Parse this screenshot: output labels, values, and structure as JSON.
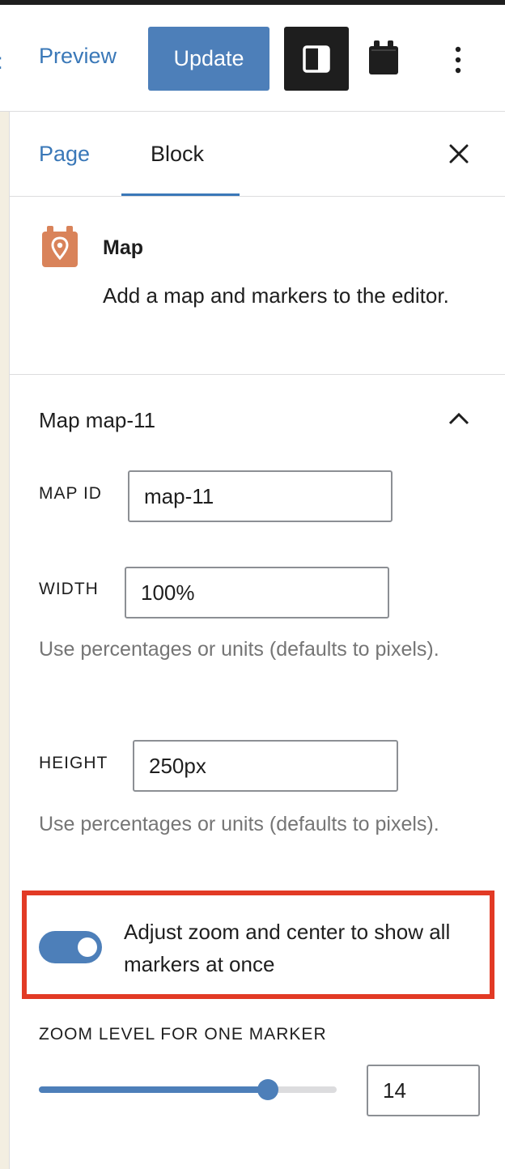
{
  "header": {
    "colon_glyph": ":",
    "preview_label": "Preview",
    "update_label": "Update"
  },
  "tabs": {
    "page_label": "Page",
    "block_label": "Block"
  },
  "block_card": {
    "title": "Map",
    "description": "Add a map and markers to the editor."
  },
  "panel": {
    "title": "Map map-11",
    "map_id": {
      "label": "MAP ID",
      "value": "map-11"
    },
    "width": {
      "label": "WIDTH",
      "value": "100%",
      "help": "Use percentages or units (defaults to pixels)."
    },
    "height": {
      "label": "HEIGHT",
      "value": "250px",
      "help": "Use percentages or units (defaults to pixels)."
    },
    "fit_markers": {
      "label": "Adjust zoom and center to show all markers at once",
      "checked": true
    },
    "zoom": {
      "label": "ZOOM LEVEL FOR ONE MARKER",
      "value": "14",
      "slider_fraction": 0.77
    }
  },
  "colors": {
    "accent": "#3a78b8",
    "button": "#4d7fb9",
    "highlight": "#e23a25",
    "block_icon": "#d9835a"
  },
  "icons": [
    "sidebar-toggle-icon",
    "plugin-calendar-icon",
    "more-vertical-icon",
    "close-icon",
    "map-pin-icon",
    "chevron-up-icon"
  ]
}
